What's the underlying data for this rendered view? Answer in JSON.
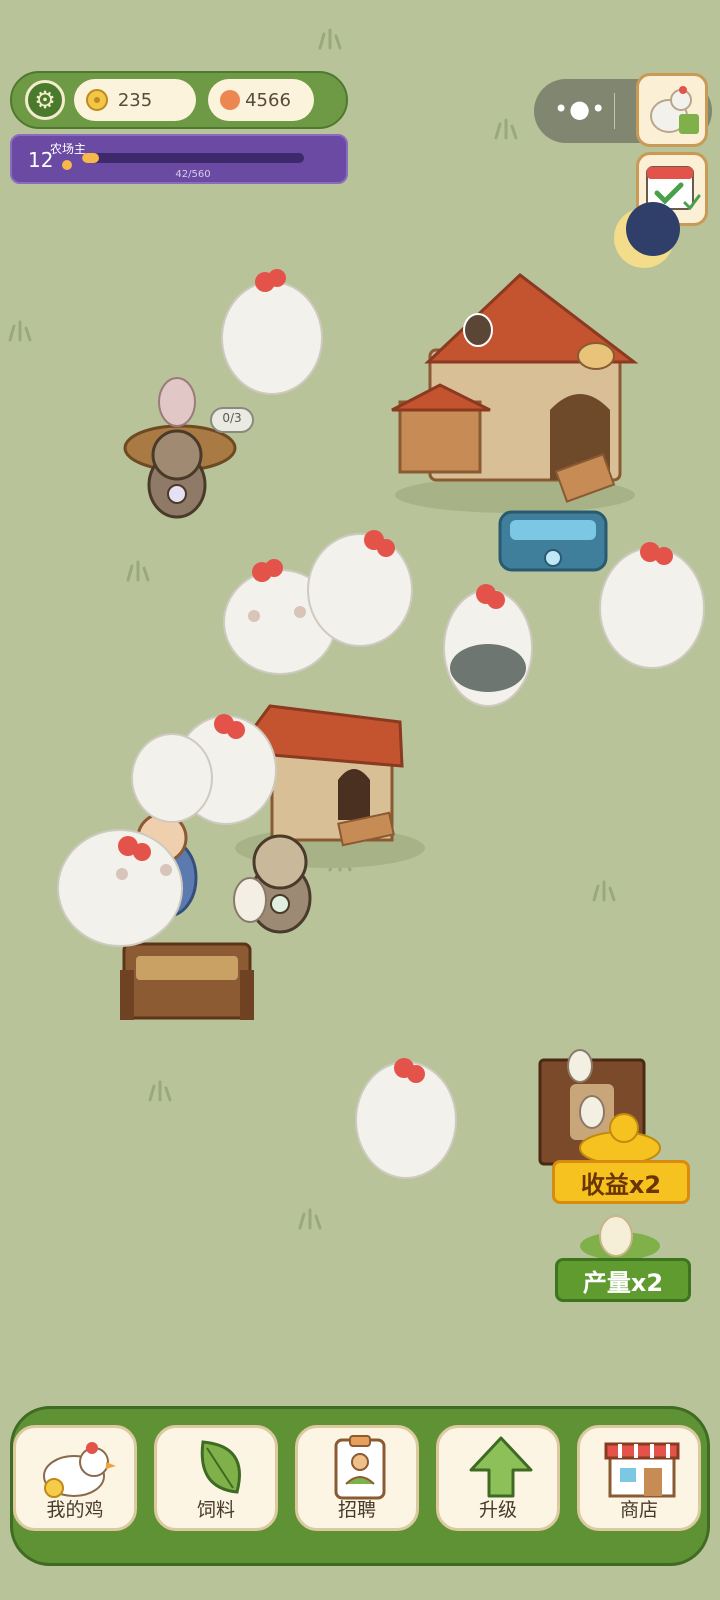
{
  "resources": {
    "coins": "235",
    "gems": "4566"
  },
  "level": {
    "number": "12",
    "title": "农场主",
    "progress_text": "42/560",
    "progress_fraction": 0.075
  },
  "nest": {
    "egg_count": "0/3"
  },
  "boosts": {
    "income": "收益x2",
    "output": "产量x2"
  },
  "nav": [
    {
      "label": "我的鸡",
      "icon": "chicken-icon"
    },
    {
      "label": "饲料",
      "icon": "leaf-icon"
    },
    {
      "label": "招聘",
      "icon": "id-badge-icon"
    },
    {
      "label": "升级",
      "icon": "upgrade-arrow-icon"
    },
    {
      "label": "商店",
      "icon": "shop-icon"
    }
  ],
  "colors": {
    "grass": "#b9c39a",
    "nav_green": "#5e9234",
    "level_purple": "#6b4aa3",
    "coin_gold": "#f2c64a"
  }
}
